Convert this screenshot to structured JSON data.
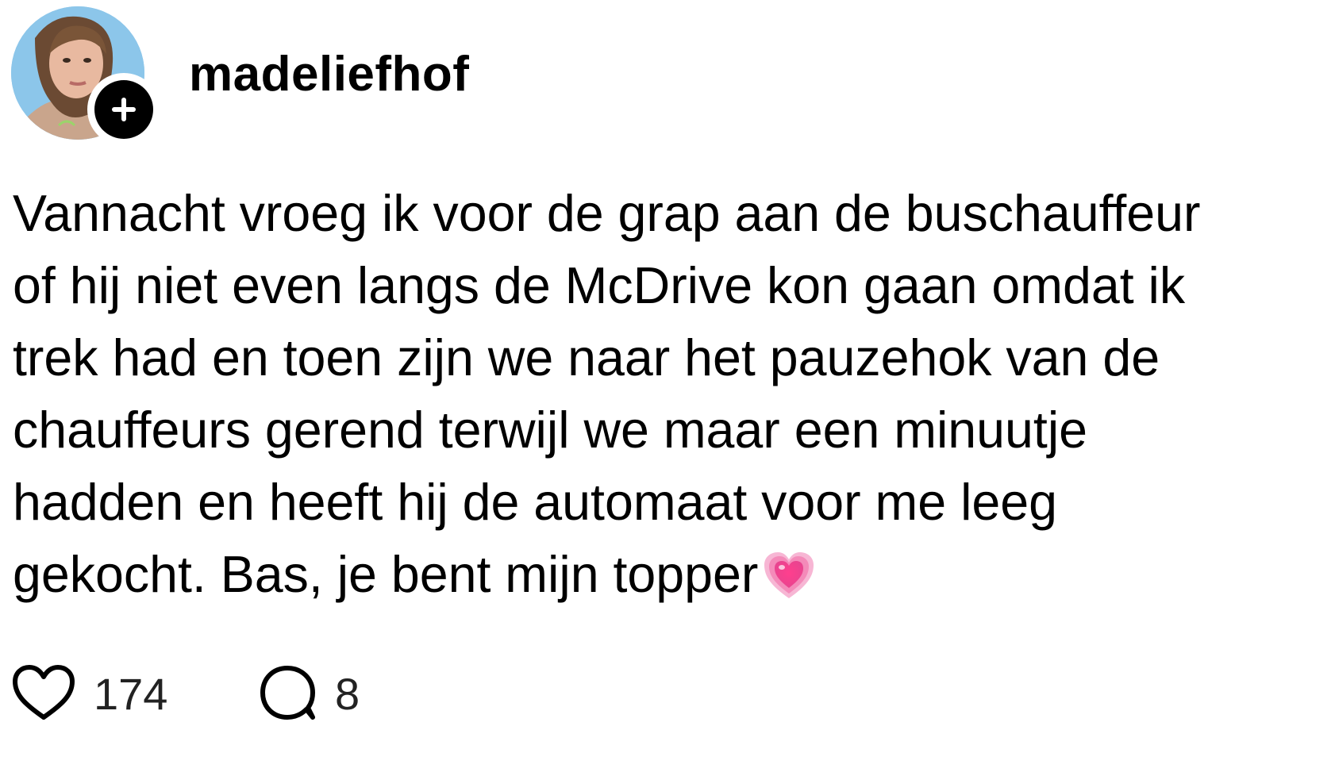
{
  "post": {
    "author": {
      "username": "madeliefhof",
      "avatar_icon": "profile-photo",
      "follow_icon": "plus-icon"
    },
    "text": "Vannacht vroeg ik voor de grap aan de buschauffeur\nof hij niet even langs de McDrive kon gaan omdat ik\ntrek had en toen zijn we naar het pauzehok van de\nchauffeurs gerend terwijl we maar een minuutje\nhadden en heeft hij de automaat voor me leeg\ngekocht. Bas, je bent mijn topper",
    "emoji_icon": "growing-heart-emoji",
    "likes": "174",
    "replies": "8"
  },
  "colors": {
    "background": "#ffffff",
    "text": "#000000",
    "count_text": "#222222",
    "emoji_pink": "#f06aa8"
  }
}
